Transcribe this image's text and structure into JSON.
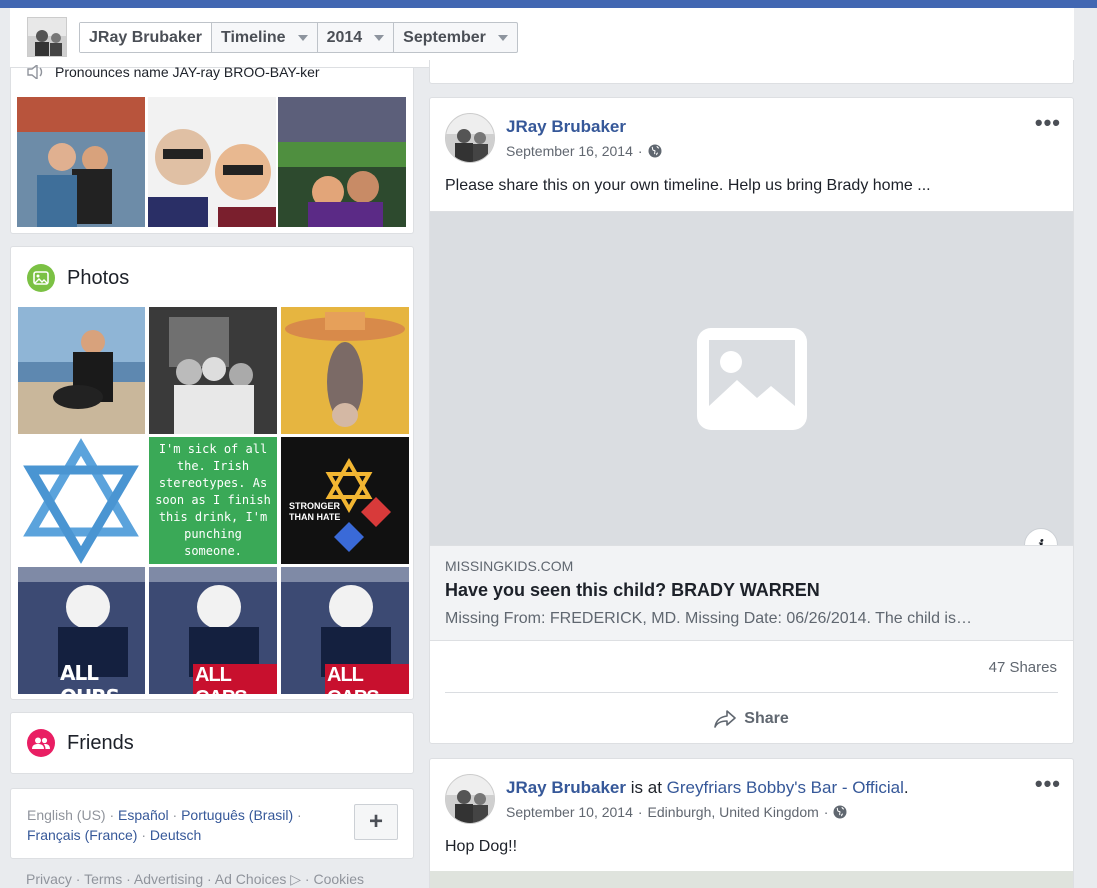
{
  "header": {
    "breadcrumb": [
      {
        "label": "JRay Brubaker",
        "dropdown": false
      },
      {
        "label": "Timeline",
        "dropdown": true
      },
      {
        "label": "2014",
        "dropdown": true
      },
      {
        "label": "September",
        "dropdown": true
      }
    ]
  },
  "intro": {
    "pronunciation": "Pronounces name JAY-ray BROO-BAY-ker"
  },
  "photos": {
    "title": "Photos",
    "tiles": [
      {
        "text": ""
      },
      {
        "text": ""
      },
      {
        "text": ""
      },
      {
        "text": ""
      },
      {
        "text": "I'm sick of all the. Irish stereotypes. As soon as I finish this drink, I'm punching someone."
      },
      {
        "text": "STRONGER THAN HATE"
      },
      {
        "text": "ALL OURS"
      },
      {
        "text": "ALL CAPS"
      },
      {
        "text": "ALL CAPS"
      }
    ]
  },
  "friends": {
    "title": "Friends"
  },
  "languages": {
    "current": "English (US)",
    "others": [
      "Español",
      "Português (Brasil)",
      "Français (France)",
      "Deutsch"
    ],
    "sep": "·",
    "more_label": "+"
  },
  "footer": {
    "links": "Privacy · Terms · Advertising · Ad Choices ▷ · Cookies"
  },
  "post1": {
    "author": "JRay Brubaker",
    "date": "September 16, 2014",
    "dot": "·",
    "more": "•••",
    "text": "Please share this on your own timeline. Help us bring Brady home ...",
    "link_domain": "MISSINGKIDS.COM",
    "link_title": "Have you seen this child? BRADY WARREN",
    "link_desc": "Missing From: FREDERICK, MD. Missing Date: 06/26/2014. The child is…",
    "info_label": "i",
    "shares": "47 Shares",
    "share_label": "Share"
  },
  "post2": {
    "author": "JRay Brubaker",
    "is_at": "is at",
    "place": "Greyfriars Bobby's Bar - Official",
    "period": ".",
    "date": "September 10, 2014",
    "dot": "·",
    "location": "Edinburgh, United Kingdom",
    "more": "•••",
    "text": "Hop Dog!!"
  },
  "colors": {
    "brand": "#4267b2",
    "link": "#365899",
    "photos_icon": "#7bc144",
    "friends_icon": "#e91e63"
  }
}
